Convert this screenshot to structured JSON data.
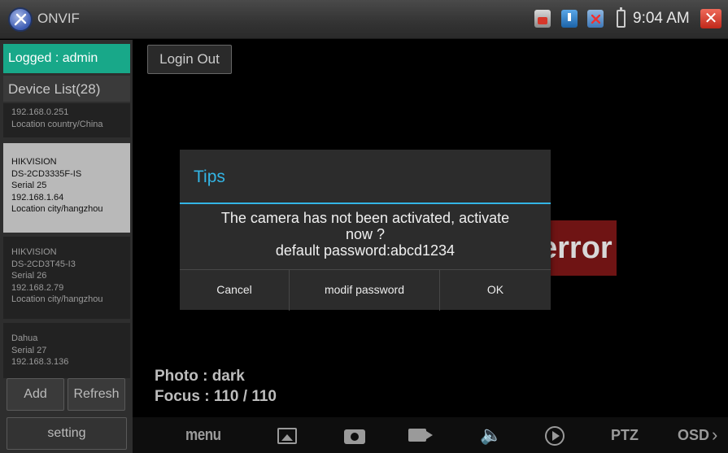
{
  "app": {
    "title": "ONVIF",
    "icon": "onvif-tools-icon"
  },
  "status_bar": {
    "time": "9:04 AM",
    "icons": [
      "camera-record-icon",
      "download-icon",
      "sd-card-error-icon",
      "battery-icon",
      "close-icon"
    ]
  },
  "sidebar": {
    "logged": "Logged : admin",
    "device_list_title": "Device List(28)",
    "devices": [
      {
        "lines": [
          "192.168.0.251",
          "Location country/China"
        ]
      },
      {
        "lines": [
          "HIKVISION",
          "DS-2CD3335F-IS",
          "Serial 25",
          "192.168.1.64",
          "Location city/hangzhou"
        ]
      },
      {
        "lines": [
          "HIKVISION",
          "DS-2CD3T45-I3",
          "Serial 26",
          "192.168.2.79",
          "Location city/hangzhou"
        ]
      },
      {
        "lines": [
          "Dahua",
          "Serial 27",
          "192.168.3.136"
        ]
      }
    ],
    "add_label": "Add",
    "refresh_label": "Refresh",
    "setting_label": "setting"
  },
  "main": {
    "login_out_label": "Login Out",
    "error_text": "error",
    "photo": "Photo : dark",
    "focus": "Focus : 110 / 110"
  },
  "dialog": {
    "title": "Tips",
    "message_line1": "The camera has not been activated, activate",
    "message_line2": "now ?",
    "message_line3": "default password:abcd1234",
    "cancel_label": "Cancel",
    "modif_password_label": "modif password",
    "ok_label": "OK"
  },
  "toolbar": {
    "menu_label": "menu",
    "ptz_label": "PTZ",
    "osd_label": "OSD",
    "icons": [
      "photo-icon",
      "camera-icon",
      "video-record-icon",
      "volume-icon",
      "play-icon",
      "chevron-right-icon"
    ]
  },
  "colors": {
    "accent_blue": "#33b5e5",
    "logged_green": "#18a889",
    "error_red": "#6f1414",
    "close_red": "#d9382a"
  }
}
